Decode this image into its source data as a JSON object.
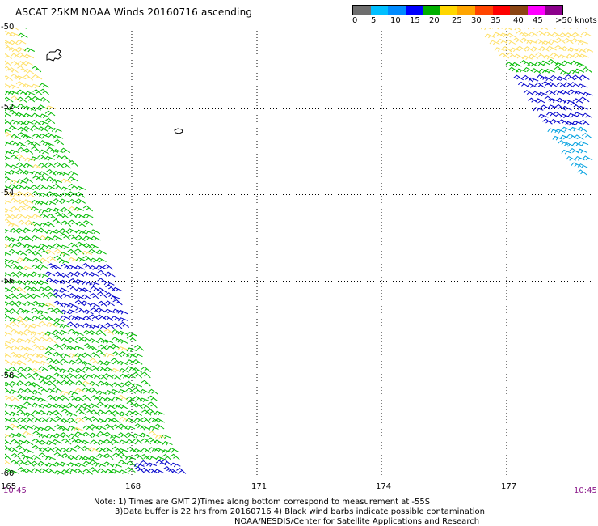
{
  "title": "ASCAT 25KM NOAA Winds 20160716 ascending",
  "legend": {
    "labels": [
      "0",
      "5",
      "10",
      "15",
      "20",
      "25",
      "30",
      "35",
      "40",
      "45",
      ">50 knots"
    ],
    "colors": [
      "#6e6e6e",
      "#00bfff",
      "#008bff",
      "#0000ff",
      "#00b000",
      "#ffd700",
      "#ffa500",
      "#ff4500",
      "#ff0000",
      "#8b4513",
      "#ff00ff",
      "#8b008b"
    ]
  },
  "map": {
    "lat_labels": [
      "-50",
      "-52",
      "-54",
      "-56",
      "-58",
      "-60"
    ],
    "lon_labels": [
      "165",
      "168",
      "171",
      "174",
      "177"
    ],
    "time_left": "10:45",
    "time_right": "10:45",
    "barb_colors": {
      "light": "#ffe066",
      "mid": "#00bb00",
      "low": "#0000cc",
      "lowest": "#00a0e0"
    }
  },
  "notes": {
    "line1": "Note: 1) Times are GMT  2)Times along bottom correspond to measurement at -55S",
    "line2": "3)Data buffer is 22 hrs from 20160716  4) Black wind barbs indicate possible contamination",
    "line3": "NOAA/NESDIS/Center for Satellite Applications and Research"
  }
}
